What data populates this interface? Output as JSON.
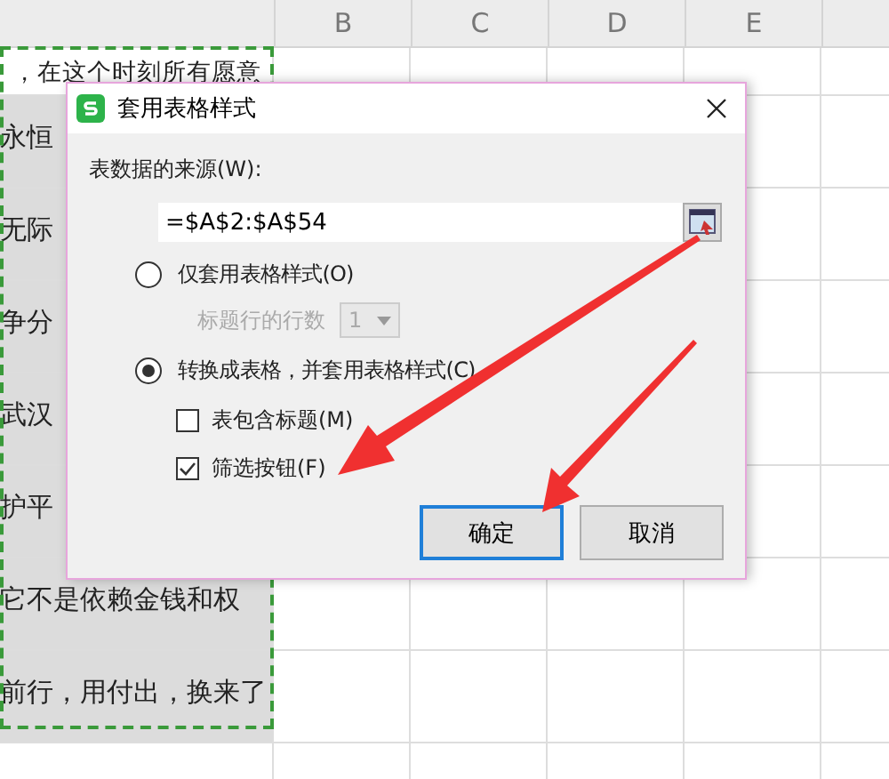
{
  "sheet": {
    "columns": [
      "",
      "B",
      "C",
      "D",
      "E"
    ],
    "rows": [
      {
        "cell_a": "，在这个时刻所有愿意"
      },
      {
        "cell_a": "永恒"
      },
      {
        "cell_a": "无际"
      },
      {
        "cell_a": "争分"
      },
      {
        "cell_a": "武汉"
      },
      {
        "cell_a": "护平"
      },
      {
        "cell_a": "它不是依赖金钱和权"
      },
      {
        "cell_a": "前行，用付出，换来了"
      }
    ]
  },
  "dialog": {
    "title": "套用表格样式",
    "source_label": "表数据的来源(W):",
    "source_value": "=$A$2:$A$54",
    "options": [
      {
        "label": "仅套用表格样式(O)",
        "selected": false
      },
      {
        "label": "转换成表格，并套用表格样式(C)",
        "selected": true
      }
    ],
    "header_rows": {
      "label": "标题行的行数",
      "value": "1",
      "disabled": true
    },
    "checkboxes": [
      {
        "label": "表包含标题(M)",
        "checked": false
      },
      {
        "label": "筛选按钮(F)",
        "checked": true
      }
    ],
    "buttons": [
      {
        "label": "确定",
        "kind": "primary"
      },
      {
        "label": "取消",
        "kind": "normal"
      }
    ]
  }
}
